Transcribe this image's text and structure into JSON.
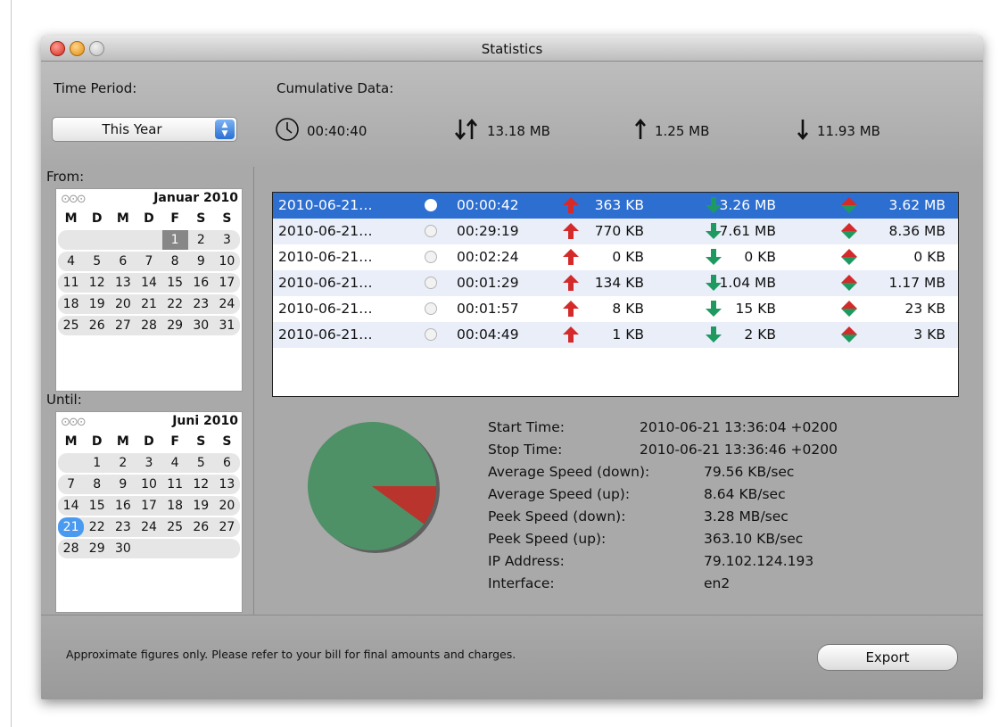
{
  "window": {
    "title": "Statistics"
  },
  "time_period": {
    "label": "Time Period:",
    "selected": "This Year"
  },
  "cumulative": {
    "label": "Cumulative Data:",
    "duration": "00:40:40",
    "total": "13.18 MB",
    "up": "1.25 MB",
    "down": "11.93 MB"
  },
  "from": {
    "label": "From:",
    "month": "Januar 2010",
    "dow": [
      "M",
      "D",
      "M",
      "D",
      "F",
      "S",
      "S"
    ],
    "weeks": [
      [
        "",
        "",
        "",
        "",
        "1",
        "2",
        "3"
      ],
      [
        "4",
        "5",
        "6",
        "7",
        "8",
        "9",
        "10"
      ],
      [
        "11",
        "12",
        "13",
        "14",
        "15",
        "16",
        "17"
      ],
      [
        "18",
        "19",
        "20",
        "21",
        "22",
        "23",
        "24"
      ],
      [
        "25",
        "26",
        "27",
        "28",
        "29",
        "30",
        "31"
      ]
    ],
    "selected_day": "1"
  },
  "until": {
    "label": "Until:",
    "month": "Juni 2010",
    "dow": [
      "M",
      "D",
      "M",
      "D",
      "F",
      "S",
      "S"
    ],
    "weeks": [
      [
        "",
        "1",
        "2",
        "3",
        "4",
        "5",
        "6"
      ],
      [
        "7",
        "8",
        "9",
        "10",
        "11",
        "12",
        "13"
      ],
      [
        "14",
        "15",
        "16",
        "17",
        "18",
        "19",
        "20"
      ],
      [
        "21",
        "22",
        "23",
        "24",
        "25",
        "26",
        "27"
      ],
      [
        "28",
        "29",
        "30",
        "",
        "",
        "",
        ""
      ]
    ],
    "today_day": "21"
  },
  "sessions": [
    {
      "date": "2010-06-21…",
      "duration": "00:00:42",
      "up": "363 KB",
      "down": "3.26 MB",
      "total": "3.62 MB",
      "selected": true
    },
    {
      "date": "2010-06-21…",
      "duration": "00:29:19",
      "up": "770 KB",
      "down": "7.61 MB",
      "total": "8.36 MB",
      "selected": false
    },
    {
      "date": "2010-06-21…",
      "duration": "00:02:24",
      "up": "0 KB",
      "down": "0 KB",
      "total": "0 KB",
      "selected": false
    },
    {
      "date": "2010-06-21…",
      "duration": "00:01:29",
      "up": "134 KB",
      "down": "1.04 MB",
      "total": "1.17 MB",
      "selected": false
    },
    {
      "date": "2010-06-21…",
      "duration": "00:01:57",
      "up": "8 KB",
      "down": "15 KB",
      "total": "23 KB",
      "selected": false
    },
    {
      "date": "2010-06-21…",
      "duration": "00:04:49",
      "up": "1 KB",
      "down": "2 KB",
      "total": "3 KB",
      "selected": false
    }
  ],
  "details": {
    "start_time": {
      "label": "Start Time:",
      "value": "2010-06-21 13:36:04 +0200"
    },
    "stop_time": {
      "label": "Stop Time:",
      "value": "2010-06-21 13:36:46 +0200"
    },
    "avg_down": {
      "label": "Average Speed (down):",
      "value": "79.56 KB/sec"
    },
    "avg_up": {
      "label": "Average Speed (up):",
      "value": "8.64 KB/sec"
    },
    "peak_down": {
      "label": "Peek Speed (down):",
      "value": "3.28 MB/sec"
    },
    "peak_up": {
      "label": "Peek Speed (up):",
      "value": "363.10 KB/sec"
    },
    "ip": {
      "label": "IP Address:",
      "value": "79.102.124.193"
    },
    "interface": {
      "label": "Interface:",
      "value": "en2"
    }
  },
  "pie": {
    "download_fraction": 0.9,
    "upload_fraction": 0.1,
    "download_color": "#4e9166",
    "upload_color": "#b8342c"
  },
  "footer": {
    "note": "Approximate figures only. Please refer to your bill for final amounts and charges.",
    "export_label": "Export"
  },
  "colors": {
    "selection": "#2d6fd1",
    "up_arrow": "#d42a2a",
    "down_arrow": "#1e9a60"
  }
}
